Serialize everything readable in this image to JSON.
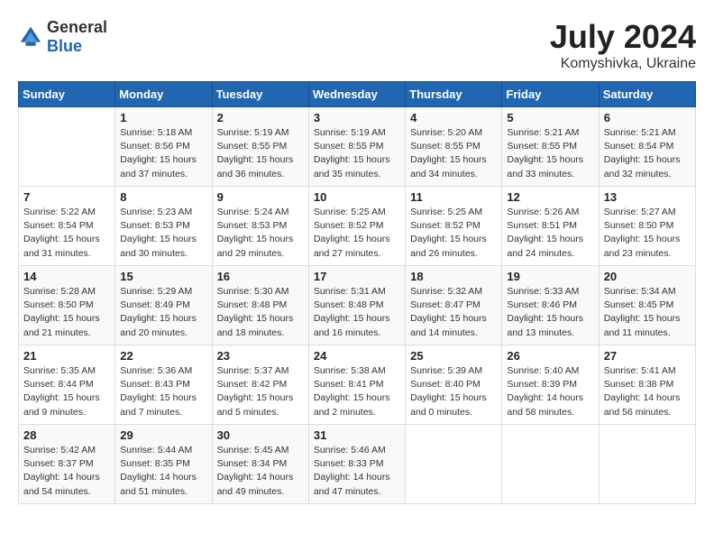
{
  "header": {
    "logo_general": "General",
    "logo_blue": "Blue",
    "month_year": "July 2024",
    "location": "Komyshivka, Ukraine"
  },
  "days_of_week": [
    "Sunday",
    "Monday",
    "Tuesday",
    "Wednesday",
    "Thursday",
    "Friday",
    "Saturday"
  ],
  "weeks": [
    [
      {
        "day": "",
        "sunrise": "",
        "sunset": "",
        "daylight": ""
      },
      {
        "day": "1",
        "sunrise": "Sunrise: 5:18 AM",
        "sunset": "Sunset: 8:56 PM",
        "daylight": "Daylight: 15 hours and 37 minutes."
      },
      {
        "day": "2",
        "sunrise": "Sunrise: 5:19 AM",
        "sunset": "Sunset: 8:55 PM",
        "daylight": "Daylight: 15 hours and 36 minutes."
      },
      {
        "day": "3",
        "sunrise": "Sunrise: 5:19 AM",
        "sunset": "Sunset: 8:55 PM",
        "daylight": "Daylight: 15 hours and 35 minutes."
      },
      {
        "day": "4",
        "sunrise": "Sunrise: 5:20 AM",
        "sunset": "Sunset: 8:55 PM",
        "daylight": "Daylight: 15 hours and 34 minutes."
      },
      {
        "day": "5",
        "sunrise": "Sunrise: 5:21 AM",
        "sunset": "Sunset: 8:55 PM",
        "daylight": "Daylight: 15 hours and 33 minutes."
      },
      {
        "day": "6",
        "sunrise": "Sunrise: 5:21 AM",
        "sunset": "Sunset: 8:54 PM",
        "daylight": "Daylight: 15 hours and 32 minutes."
      }
    ],
    [
      {
        "day": "7",
        "sunrise": "Sunrise: 5:22 AM",
        "sunset": "Sunset: 8:54 PM",
        "daylight": "Daylight: 15 hours and 31 minutes."
      },
      {
        "day": "8",
        "sunrise": "Sunrise: 5:23 AM",
        "sunset": "Sunset: 8:53 PM",
        "daylight": "Daylight: 15 hours and 30 minutes."
      },
      {
        "day": "9",
        "sunrise": "Sunrise: 5:24 AM",
        "sunset": "Sunset: 8:53 PM",
        "daylight": "Daylight: 15 hours and 29 minutes."
      },
      {
        "day": "10",
        "sunrise": "Sunrise: 5:25 AM",
        "sunset": "Sunset: 8:52 PM",
        "daylight": "Daylight: 15 hours and 27 minutes."
      },
      {
        "day": "11",
        "sunrise": "Sunrise: 5:25 AM",
        "sunset": "Sunset: 8:52 PM",
        "daylight": "Daylight: 15 hours and 26 minutes."
      },
      {
        "day": "12",
        "sunrise": "Sunrise: 5:26 AM",
        "sunset": "Sunset: 8:51 PM",
        "daylight": "Daylight: 15 hours and 24 minutes."
      },
      {
        "day": "13",
        "sunrise": "Sunrise: 5:27 AM",
        "sunset": "Sunset: 8:50 PM",
        "daylight": "Daylight: 15 hours and 23 minutes."
      }
    ],
    [
      {
        "day": "14",
        "sunrise": "Sunrise: 5:28 AM",
        "sunset": "Sunset: 8:50 PM",
        "daylight": "Daylight: 15 hours and 21 minutes."
      },
      {
        "day": "15",
        "sunrise": "Sunrise: 5:29 AM",
        "sunset": "Sunset: 8:49 PM",
        "daylight": "Daylight: 15 hours and 20 minutes."
      },
      {
        "day": "16",
        "sunrise": "Sunrise: 5:30 AM",
        "sunset": "Sunset: 8:48 PM",
        "daylight": "Daylight: 15 hours and 18 minutes."
      },
      {
        "day": "17",
        "sunrise": "Sunrise: 5:31 AM",
        "sunset": "Sunset: 8:48 PM",
        "daylight": "Daylight: 15 hours and 16 minutes."
      },
      {
        "day": "18",
        "sunrise": "Sunrise: 5:32 AM",
        "sunset": "Sunset: 8:47 PM",
        "daylight": "Daylight: 15 hours and 14 minutes."
      },
      {
        "day": "19",
        "sunrise": "Sunrise: 5:33 AM",
        "sunset": "Sunset: 8:46 PM",
        "daylight": "Daylight: 15 hours and 13 minutes."
      },
      {
        "day": "20",
        "sunrise": "Sunrise: 5:34 AM",
        "sunset": "Sunset: 8:45 PM",
        "daylight": "Daylight: 15 hours and 11 minutes."
      }
    ],
    [
      {
        "day": "21",
        "sunrise": "Sunrise: 5:35 AM",
        "sunset": "Sunset: 8:44 PM",
        "daylight": "Daylight: 15 hours and 9 minutes."
      },
      {
        "day": "22",
        "sunrise": "Sunrise: 5:36 AM",
        "sunset": "Sunset: 8:43 PM",
        "daylight": "Daylight: 15 hours and 7 minutes."
      },
      {
        "day": "23",
        "sunrise": "Sunrise: 5:37 AM",
        "sunset": "Sunset: 8:42 PM",
        "daylight": "Daylight: 15 hours and 5 minutes."
      },
      {
        "day": "24",
        "sunrise": "Sunrise: 5:38 AM",
        "sunset": "Sunset: 8:41 PM",
        "daylight": "Daylight: 15 hours and 2 minutes."
      },
      {
        "day": "25",
        "sunrise": "Sunrise: 5:39 AM",
        "sunset": "Sunset: 8:40 PM",
        "daylight": "Daylight: 15 hours and 0 minutes."
      },
      {
        "day": "26",
        "sunrise": "Sunrise: 5:40 AM",
        "sunset": "Sunset: 8:39 PM",
        "daylight": "Daylight: 14 hours and 58 minutes."
      },
      {
        "day": "27",
        "sunrise": "Sunrise: 5:41 AM",
        "sunset": "Sunset: 8:38 PM",
        "daylight": "Daylight: 14 hours and 56 minutes."
      }
    ],
    [
      {
        "day": "28",
        "sunrise": "Sunrise: 5:42 AM",
        "sunset": "Sunset: 8:37 PM",
        "daylight": "Daylight: 14 hours and 54 minutes."
      },
      {
        "day": "29",
        "sunrise": "Sunrise: 5:44 AM",
        "sunset": "Sunset: 8:35 PM",
        "daylight": "Daylight: 14 hours and 51 minutes."
      },
      {
        "day": "30",
        "sunrise": "Sunrise: 5:45 AM",
        "sunset": "Sunset: 8:34 PM",
        "daylight": "Daylight: 14 hours and 49 minutes."
      },
      {
        "day": "31",
        "sunrise": "Sunrise: 5:46 AM",
        "sunset": "Sunset: 8:33 PM",
        "daylight": "Daylight: 14 hours and 47 minutes."
      },
      {
        "day": "",
        "sunrise": "",
        "sunset": "",
        "daylight": ""
      },
      {
        "day": "",
        "sunrise": "",
        "sunset": "",
        "daylight": ""
      },
      {
        "day": "",
        "sunrise": "",
        "sunset": "",
        "daylight": ""
      }
    ]
  ]
}
